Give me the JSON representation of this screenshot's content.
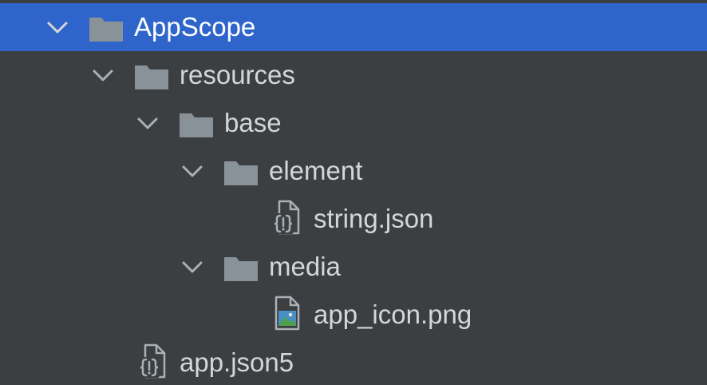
{
  "project_tree": {
    "items": [
      {
        "label": "AppScope",
        "icon": "folder-icon",
        "expanded": true,
        "selected": true
      },
      {
        "label": "resources",
        "icon": "folder-icon",
        "expanded": true
      },
      {
        "label": "base",
        "icon": "folder-icon",
        "expanded": true
      },
      {
        "label": "element",
        "icon": "folder-icon",
        "expanded": true
      },
      {
        "label": "string.json",
        "icon": "json-file-icon"
      },
      {
        "label": "media",
        "icon": "folder-icon",
        "expanded": true
      },
      {
        "label": "app_icon.png",
        "icon": "image-file-icon"
      },
      {
        "label": "app.json5",
        "icon": "json-file-icon"
      }
    ]
  },
  "colors": {
    "background": "#3c3f41",
    "selection": "#2f65ca",
    "folder": "#8a9299",
    "text": "#d4d7d9"
  }
}
